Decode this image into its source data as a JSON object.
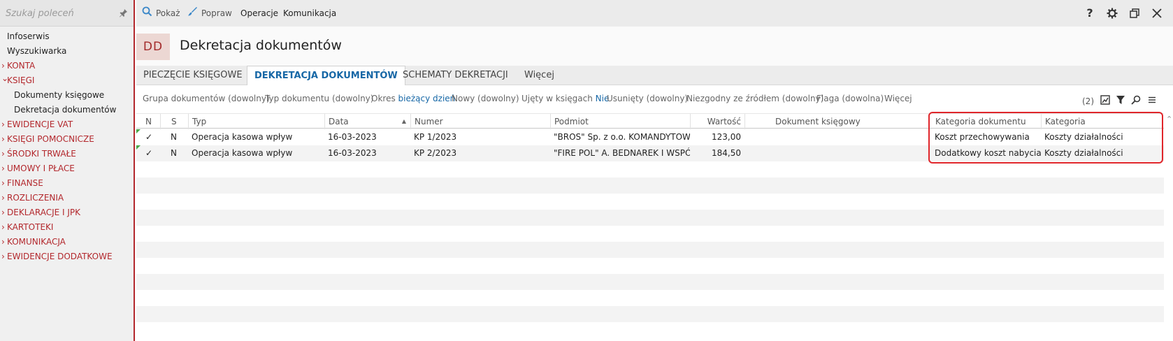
{
  "search": {
    "placeholder": "Szukaj poleceń"
  },
  "sidebar": {
    "items": [
      {
        "label": "Infoserwis"
      },
      {
        "label": "Wyszukiwarka"
      },
      {
        "label": "KONTA"
      },
      {
        "label": "KSIĘGI"
      },
      {
        "label": "Dokumenty księgowe"
      },
      {
        "label": "Dekretacja dokumentów"
      },
      {
        "label": "EWIDENCJE VAT"
      },
      {
        "label": "KSIĘGI POMOCNICZE"
      },
      {
        "label": "ŚRODKI TRWAŁE"
      },
      {
        "label": "UMOWY I PŁACE"
      },
      {
        "label": "FINANSE"
      },
      {
        "label": "ROZLICZENIA"
      },
      {
        "label": "DEKLARACJE I JPK"
      },
      {
        "label": "KARTOTEKI"
      },
      {
        "label": "KOMUNIKACJA"
      },
      {
        "label": "EWIDENCJE DODATKOWE"
      }
    ]
  },
  "toolbar": {
    "show": "Pokaż",
    "edit": "Popraw",
    "operations": "Operacje",
    "communication": "Komunikacja",
    "help": "?"
  },
  "header": {
    "badge": "DD",
    "title": "Dekretacja dokumentów"
  },
  "tabs": [
    {
      "label": "PIECZĘCIE KSIĘGOWE"
    },
    {
      "label": "DEKRETACJA DOKUMENTÓW"
    },
    {
      "label": "SCHEMATY DEKRETACJI"
    },
    {
      "label": "Więcej"
    }
  ],
  "filters": {
    "group": "Grupa dokumentów (dowolny)",
    "type": "Typ dokumentu (dowolny)",
    "period_label": "Okres",
    "period_value": "bieżący dzień",
    "new": "Nowy (dowolny)",
    "included_label": "Ujęty w księgach",
    "included_value": "Nie",
    "removed": "Usunięty (dowolny)",
    "mismatch": "Niezgodny ze źródłem (dowolny)",
    "flag": "Flaga (dowolna)",
    "more": "Więcej",
    "count": "(2)"
  },
  "table": {
    "headers": {
      "n": "N",
      "s": "S",
      "typ": "Typ",
      "data": "Data",
      "numer": "Numer",
      "podmiot": "Podmiot",
      "wartosc": "Wartość",
      "dokument": "Dokument księgowy",
      "kat_dok": "Kategoria dokumentu",
      "kategoria": "Kategoria"
    },
    "rows": [
      {
        "n": "✓",
        "s": "N",
        "typ": "Operacja kasowa wpływ",
        "data": "16-03-2023",
        "numer": "KP 1/2023",
        "podmiot": "\"BROS\" Sp. z o.o. KOMANDYTOWA",
        "wartosc": "123,00",
        "dokument": "",
        "kat_dok": "Koszt przechowywania",
        "kategoria": "Koszty działalności"
      },
      {
        "n": "✓",
        "s": "N",
        "typ": "Operacja kasowa wpływ",
        "data": "16-03-2023",
        "numer": "KP 2/2023",
        "podmiot": "\"FIRE POL\" A. BEDNAREK I WSPÓL...",
        "wartosc": "184,50",
        "dokument": "",
        "kat_dok": "Dodatkowy koszt nabycia",
        "kategoria": "Koszty działalności"
      }
    ]
  },
  "colors": {
    "accent": "#b3282d",
    "link": "#1667a6",
    "highlight": "#e0262b"
  }
}
